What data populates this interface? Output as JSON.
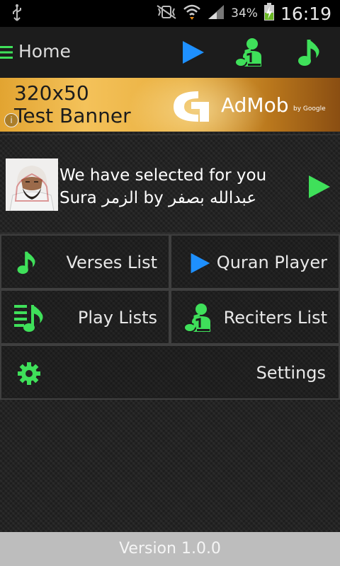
{
  "status_bar": {
    "battery_percent": "34%",
    "time": "16:19",
    "icons": [
      "usb-icon",
      "mute-vibrate-icon",
      "wifi-icon",
      "signal-icon",
      "battery-charging-icon"
    ]
  },
  "action_bar": {
    "title": "Home",
    "icons": [
      "menu-icon",
      "play-icon",
      "reciter-icon",
      "music-note-icon"
    ]
  },
  "ad_banner": {
    "text_line1": "320x50",
    "text_line2": "Test Banner",
    "brand": "AdMob",
    "by": "by Google"
  },
  "featured": {
    "line1": "We have selected for you",
    "line2": "Sura الزمر by عبدالله بصفر"
  },
  "menu": {
    "verses_list": "Verses List",
    "quran_player": "Quran Player",
    "play_lists": "Play Lists",
    "reciters_list": "Reciters List",
    "settings": "Settings"
  },
  "footer": {
    "version": "Version 1.0.0"
  },
  "colors": {
    "accent_green": "#3fe05a",
    "accent_blue": "#1e90ff"
  }
}
